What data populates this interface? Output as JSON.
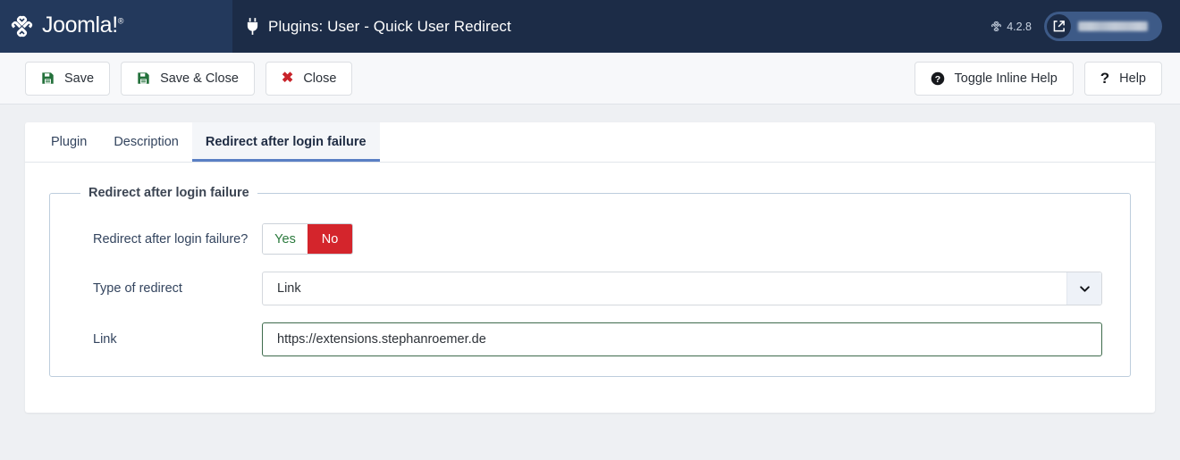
{
  "header": {
    "brand_name": "Joomla!",
    "brand_registered": "®",
    "title": "Plugins: User - Quick User Redirect",
    "plug_icon": "plug-icon",
    "version": "4.2.8",
    "version_icon": "joomla-mark-icon",
    "user_pill_icon": "external-link-icon",
    "user_pill_name": ""
  },
  "toolbar": {
    "left_buttons": [
      {
        "label": "Save",
        "icon": "save-disk-icon"
      },
      {
        "label": "Save & Close",
        "icon": "save-disk-icon"
      },
      {
        "label": "Close",
        "icon": "close-x-icon"
      }
    ],
    "right_buttons": [
      {
        "label": "Toggle Inline Help",
        "icon": "question-circle-icon"
      },
      {
        "label": "Help",
        "icon": "question-mark-icon"
      }
    ]
  },
  "tabs": [
    {
      "label": "Plugin",
      "active": false
    },
    {
      "label": "Description",
      "active": false
    },
    {
      "label": "Redirect after login failure",
      "active": true
    }
  ],
  "form": {
    "legend": "Redirect after login failure",
    "rows": [
      {
        "label": "Redirect after login failure?",
        "type": "switcher",
        "options": [
          "Yes",
          "No"
        ],
        "value": "No"
      },
      {
        "label": "Type of redirect",
        "type": "select",
        "value": "Link",
        "arrow_icon": "chevron-down-icon"
      },
      {
        "label": "Link",
        "type": "text",
        "value": "https://extensions.stephanroemer.de",
        "placeholder": ""
      }
    ]
  },
  "colors": {
    "header_bg": "#1c2c47",
    "brand_bg": "#23395c",
    "accent_blue": "#5a7fc4",
    "danger_red": "#d4252c",
    "success_green": "#2b7a3d",
    "page_bg": "#eef0f3"
  }
}
